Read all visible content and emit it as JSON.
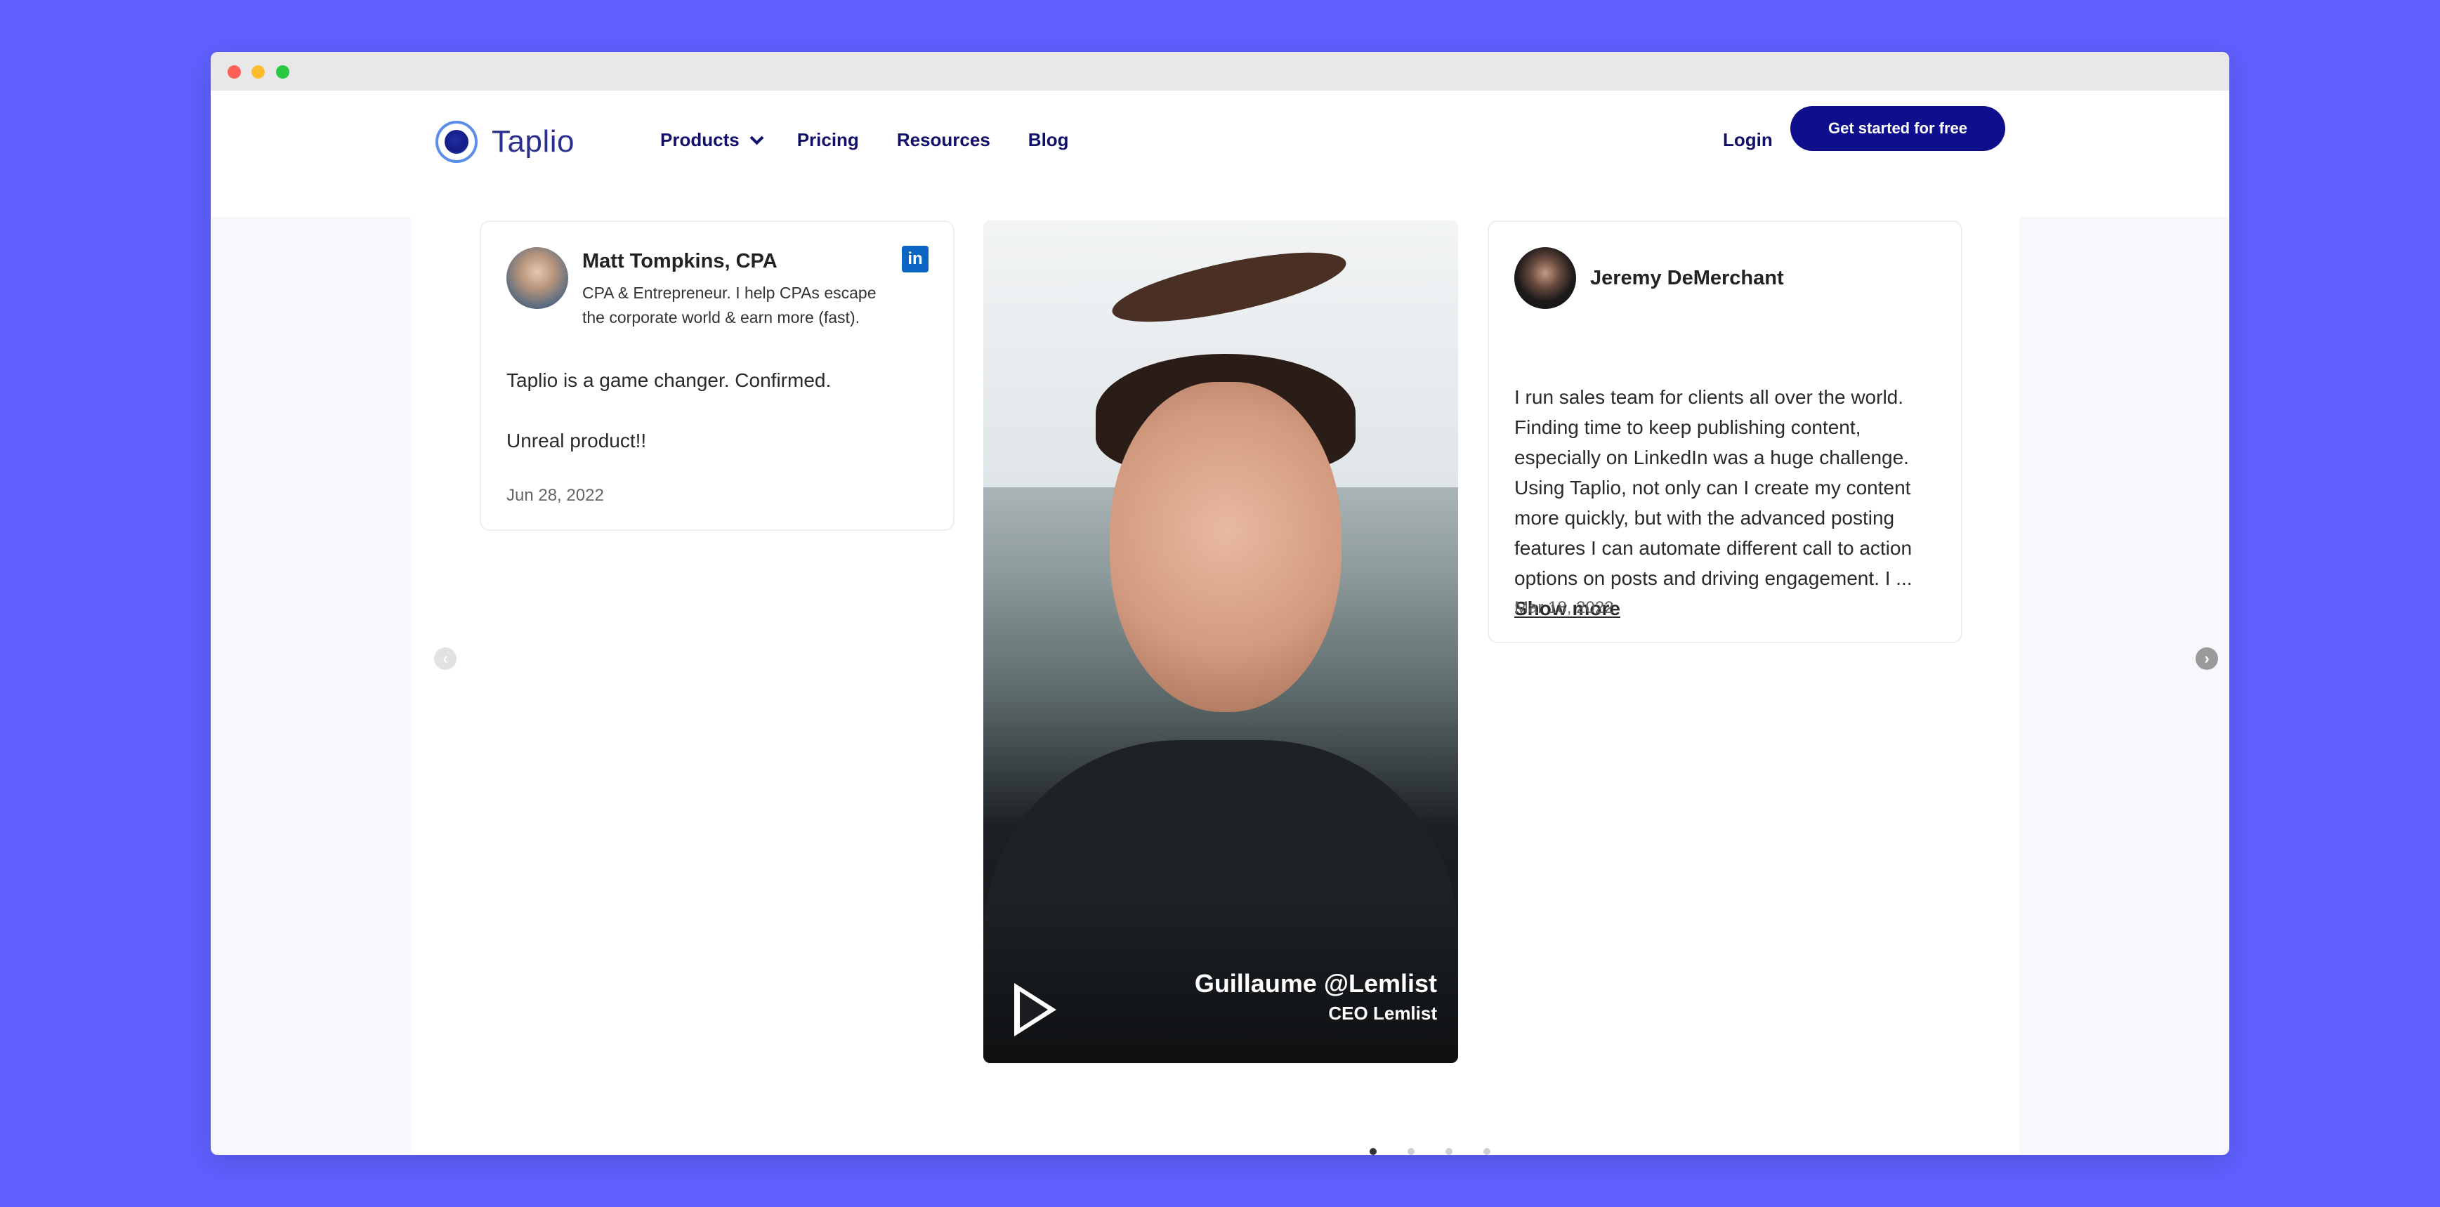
{
  "brand": {
    "name": "Taplio"
  },
  "nav": {
    "products": "Products",
    "pricing": "Pricing",
    "resources": "Resources",
    "blog": "Blog",
    "login": "Login",
    "cta": "Get started for free"
  },
  "testimonials": {
    "card1": {
      "name": "Matt Tompkins, CPA",
      "bio": "CPA & Entrepreneur. I help CPAs escape the corporate world & earn more (fast).",
      "line1": "Taplio is a game changer. Confirmed.",
      "line2": "Unreal product!!",
      "date": "Jun 28, 2022",
      "linkedin_icon": "in"
    },
    "video": {
      "name": "Guillaume @Lemlist",
      "title": "CEO Lemlist"
    },
    "card3": {
      "name": "Jeremy DeMerchant",
      "text": "I run sales team for clients all over the world. Finding time to keep publishing content, especially on LinkedIn was a huge challenge. Using Taplio, not only can I create my content more quickly, but with the advanced posting features I can automate different call to action options on posts and driving engagement. I ...",
      "show_more": "Show more",
      "date": "Mar 18, 2022"
    }
  },
  "carousel": {
    "prev_icon": "‹",
    "next_icon": "›",
    "active_page": 1,
    "page_count": 4
  },
  "colors": {
    "background": "#5f60ff",
    "primary": "#0f0f8e",
    "nav_text": "#10106a"
  }
}
